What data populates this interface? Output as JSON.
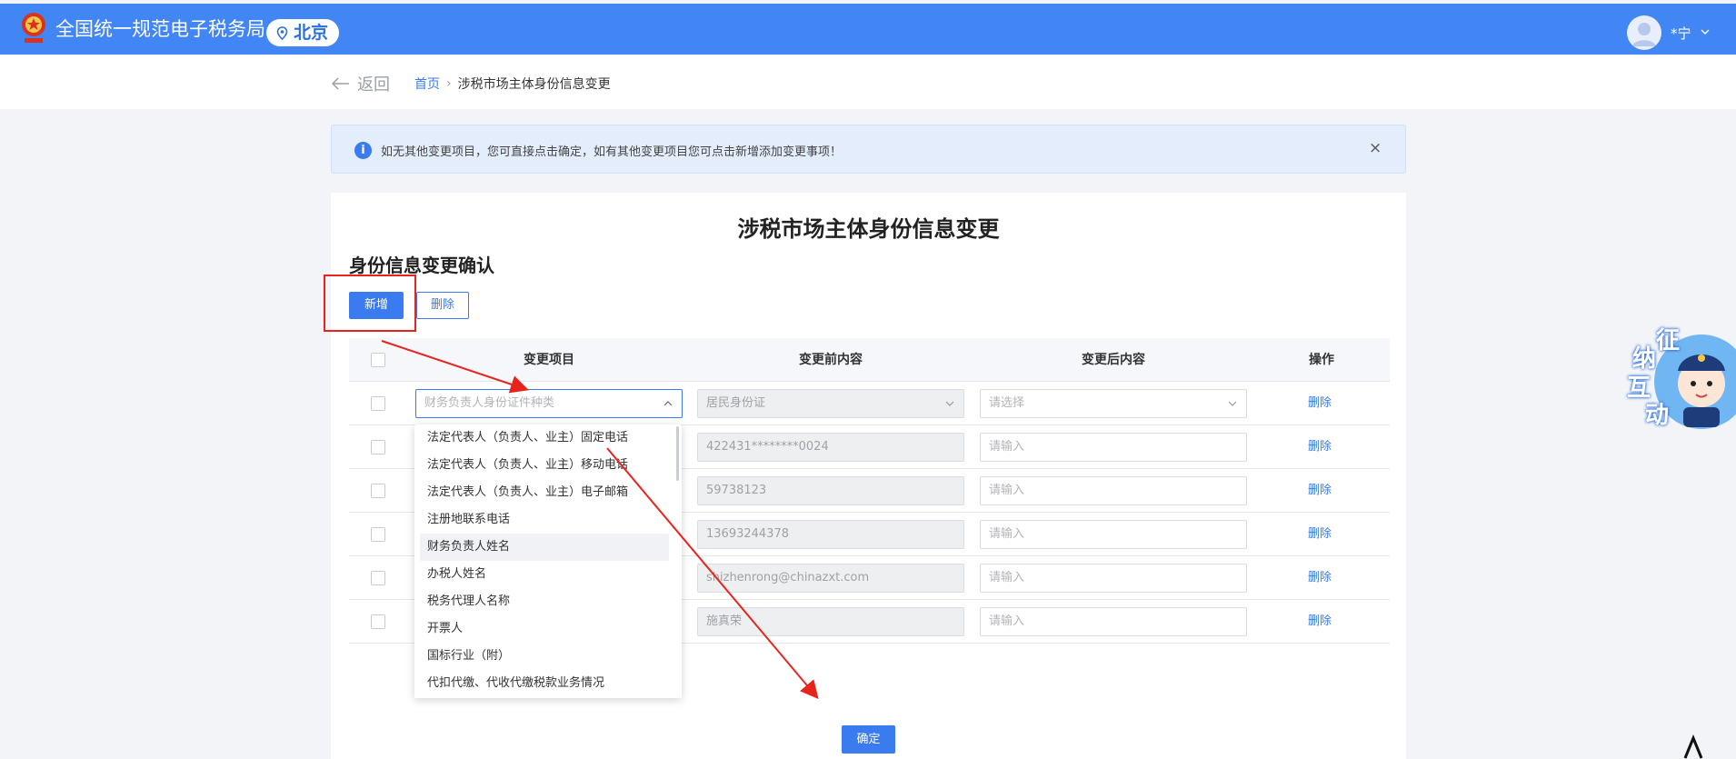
{
  "header": {
    "app_title": "全国统一规范电子税务局",
    "region": "北京",
    "user_name": "*宁"
  },
  "breadcrumb": {
    "back": "返回",
    "home": "首页",
    "separator": "›",
    "current": "涉税市场主体身份信息变更"
  },
  "alert": {
    "text": "如无其他变更项目，您可直接点击确定，如有其他变更项目您可点击新增添加变更事项！",
    "close": "×"
  },
  "form": {
    "title": "涉税市场主体身份信息变更",
    "section_title": "身份信息变更确认",
    "add_label": "新增",
    "delete_label": "删除",
    "confirm_label": "确定"
  },
  "table": {
    "headers": [
      "变更项目",
      "变更前内容",
      "变更后内容",
      "操作"
    ],
    "rows": [
      {
        "item": "财务负责人身份证件种类",
        "before": "居民身份证",
        "after": "请选择",
        "op": "删除"
      },
      {
        "item": "",
        "before": "422431********0024",
        "after": "请输入",
        "op": "删除"
      },
      {
        "item": "",
        "before": "59738123",
        "after": "请输入",
        "op": "删除"
      },
      {
        "item": "",
        "before": "13693244378",
        "after": "请输入",
        "op": "删除"
      },
      {
        "item": "",
        "before": "shizhenrong@chinazxt.com",
        "after": "请输入",
        "op": "删除"
      },
      {
        "item": "",
        "before": "施真荣",
        "after": "请输入",
        "op": "删除"
      }
    ]
  },
  "dropdown": {
    "options": [
      "法定代表人（负责人、业主）固定电话",
      "法定代表人（负责人、业主）移动电话",
      "法定代表人（负责人、业主）电子邮箱",
      "注册地联系电话",
      "财务负责人姓名",
      "办税人姓名",
      "税务代理人名称",
      "开票人",
      "国标行业（附）",
      "代扣代缴、代收代缴税款业务情况"
    ],
    "hovered_index": 4
  },
  "mascot": {
    "text": [
      "征",
      "纳",
      "互",
      "动"
    ]
  },
  "colors": {
    "brand": "#4285f4",
    "accent": "#3a7bf0",
    "annotation": "#e8231c"
  }
}
